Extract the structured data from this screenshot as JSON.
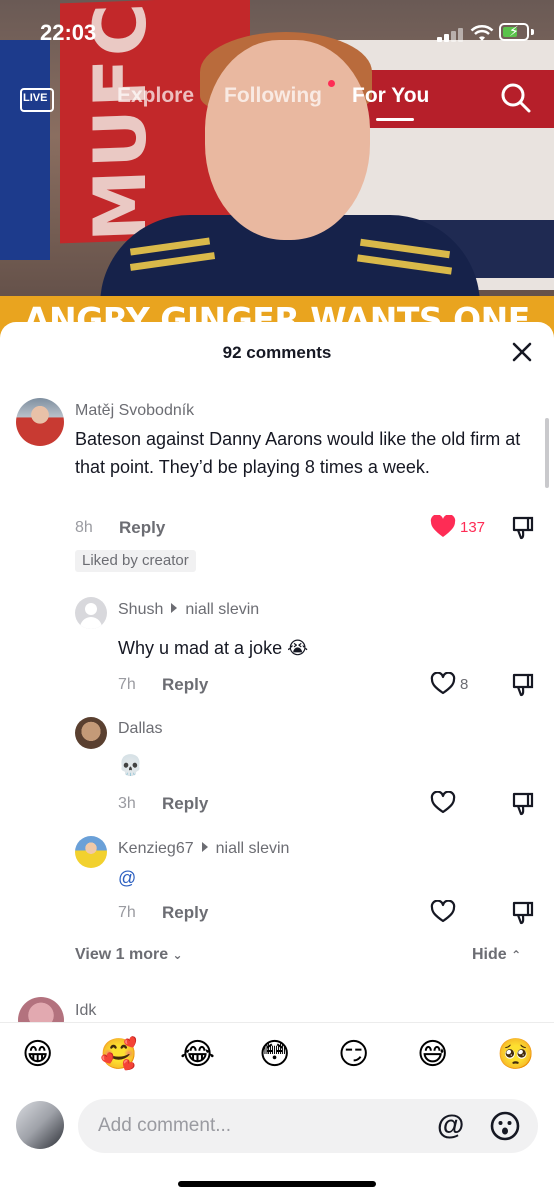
{
  "status_bar": {
    "time": "22:03"
  },
  "top_nav": {
    "live_label": "LIVE",
    "tabs": [
      {
        "label": "Explore"
      },
      {
        "label": "Following"
      },
      {
        "label": "For You"
      }
    ],
    "active_tab": "For You"
  },
  "video": {
    "caption": "ANGRY GINGER WANTS ONE"
  },
  "comments_panel": {
    "count_label": "92 comments",
    "comments": [
      {
        "author": "Matěj Svobodník",
        "text": "Bateson against Danny Aarons would like the old firm at that point. They’d be playing 8 times a week.",
        "time": "8h",
        "reply_label": "Reply",
        "likes": "137",
        "liked": true,
        "badge": "Liked by creator"
      }
    ],
    "replies": [
      {
        "author": "Shush",
        "reply_to": "niall slevin",
        "text": "Why u mad at a joke 😭",
        "time": "7h",
        "reply_label": "Reply",
        "likes": "8"
      },
      {
        "author": "Dallas",
        "text": "💀",
        "time": "3h",
        "reply_label": "Reply",
        "likes": ""
      },
      {
        "author": "Kenzieg67",
        "reply_to": "niall slevin",
        "text": "@",
        "time": "7h",
        "reply_label": "Reply",
        "likes": ""
      }
    ],
    "view_more_label": "View 1 more",
    "hide_label": "Hide",
    "next_author": "Idk"
  },
  "emoji_bar": [
    "😁",
    "🥰",
    "😂",
    "😳",
    "😏",
    "😅",
    "🥺"
  ],
  "comment_input": {
    "placeholder": "Add comment...",
    "at_label": "@"
  }
}
